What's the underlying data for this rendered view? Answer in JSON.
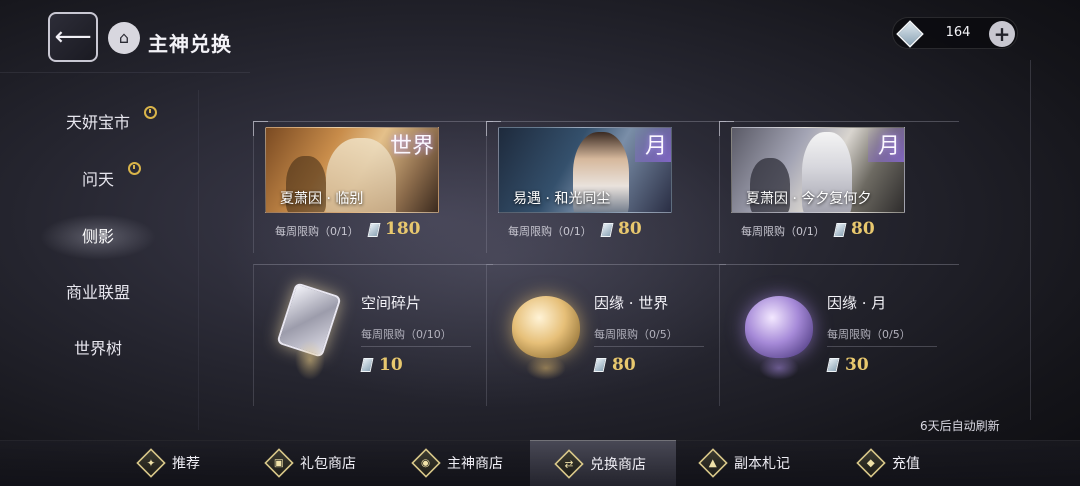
{
  "header": {
    "back_icon": "arrow-back-icon",
    "home_icon": "home-icon",
    "title": "主神兑换"
  },
  "currency": {
    "amount": "164",
    "icon": "diamond-gem-icon",
    "plus_label": "+"
  },
  "sidebar": {
    "items": [
      {
        "label": "天妍宝市",
        "timed": true
      },
      {
        "label": "问天",
        "timed": true
      },
      {
        "label": "侧影",
        "timed": false,
        "active": true
      },
      {
        "label": "商业联盟",
        "timed": false
      },
      {
        "label": "世界树",
        "timed": false
      }
    ]
  },
  "cards": [
    {
      "name": "夏萧因 · 临别",
      "tag": "世界",
      "limit": "每周限购（0/1）",
      "price": "180"
    },
    {
      "name": "易遇 · 和光同尘",
      "tag": "月",
      "limit": "每周限购（0/1）",
      "price": "80"
    },
    {
      "name": "夏萧因 · 今夕复何夕",
      "tag": "月",
      "limit": "每周限购（0/1）",
      "price": "80"
    }
  ],
  "items": [
    {
      "name": "空间碎片",
      "limit": "每周限购（0/10）",
      "price": "10"
    },
    {
      "name": "因缘 · 世界",
      "limit": "每周限购（0/5）",
      "price": "80"
    },
    {
      "name": "因缘 · 月",
      "limit": "每周限购（0/5）",
      "price": "30"
    }
  ],
  "refresh_note": "6天后自动刷新",
  "bottom_nav": [
    {
      "label": "推荐",
      "icon": "flame-icon",
      "glyph": "✦"
    },
    {
      "label": "礼包商店",
      "icon": "gift-icon",
      "glyph": "▣"
    },
    {
      "label": "主神商店",
      "icon": "planet-icon",
      "glyph": "◉"
    },
    {
      "label": "兑换商店",
      "icon": "exchange-icon",
      "glyph": "⇄",
      "active": true
    },
    {
      "label": "副本札记",
      "icon": "triangle-icon",
      "glyph": "▲"
    },
    {
      "label": "充值",
      "icon": "recharge-icon",
      "glyph": "◆"
    }
  ],
  "colors": {
    "accent_gold": "#e8c86e",
    "moon_tag_purple": "#8b6bd6"
  }
}
